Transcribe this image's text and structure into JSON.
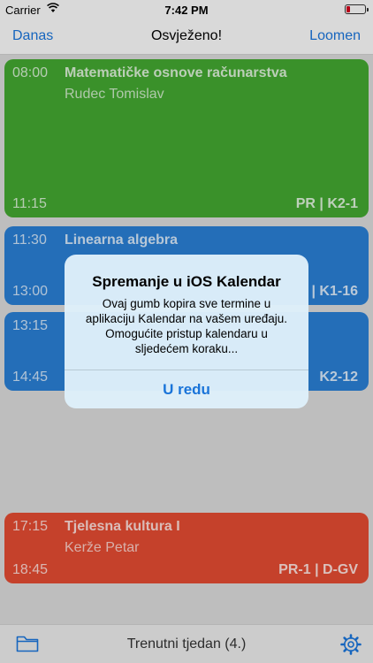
{
  "status": {
    "carrier": "Carrier",
    "time": "7:42 PM"
  },
  "nav": {
    "left": "Danas",
    "title": "Osvježeno!",
    "right": "Loomen"
  },
  "colors": {
    "accent": "#1a74d9",
    "green": "#43a630",
    "blue": "#2a7ed2",
    "red": "#e14a32"
  },
  "events": [
    {
      "start": "08:00",
      "end": "11:15",
      "title": "Matematičke osnove računarstva",
      "teacher": "Rudec Tomislav",
      "room": "PR | K2-1"
    },
    {
      "start": "11:30",
      "end": "13:00",
      "title": "Linearna algebra",
      "teacher": "",
      "room": "| K1-16"
    },
    {
      "start": "13:15",
      "end": "14:45",
      "title": "",
      "teacher": "",
      "room": "K2-12"
    },
    {
      "start": "17:15",
      "end": "18:45",
      "title": "Tjelesna kultura I",
      "teacher": "Kerže Petar",
      "room": "PR-1 | D-GV"
    }
  ],
  "alert": {
    "title": "Spremanje u iOS Kalendar",
    "message": "Ovaj gumb kopira sve termine u aplikaciju Kalendar na vašem uređaju. Omogućite pristup kalendaru u sljedećem koraku...",
    "button": "U redu"
  },
  "bottom": {
    "week": "Trenutni tjedan (4.)",
    "left_icon": "folder-icon",
    "right_icon": "gear-icon"
  }
}
